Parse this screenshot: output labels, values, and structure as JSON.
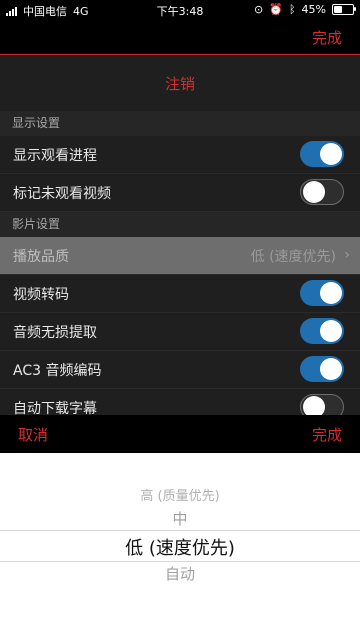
{
  "status_bar": {
    "carrier": "中国电信",
    "network": "4G",
    "time": "下午3:48",
    "battery": "45%",
    "battery_level": 0.45
  },
  "header": {
    "done_label": "完成"
  },
  "actions": {
    "logout_label": "注销"
  },
  "sections": {
    "display": {
      "title": "显示设置",
      "items": [
        {
          "label": "显示观看进程",
          "toggle": true
        },
        {
          "label": "标记未观看视频",
          "toggle": false
        }
      ]
    },
    "video": {
      "title": "影片设置",
      "quality": {
        "label": "播放品质",
        "value": "低 (速度优先)"
      },
      "items": [
        {
          "label": "视频转码",
          "toggle": true
        },
        {
          "label": "音频无损提取",
          "toggle": true
        },
        {
          "label": "AC3 音频编码",
          "toggle": true
        },
        {
          "label": "自动下载字幕",
          "toggle": false
        }
      ]
    }
  },
  "picker": {
    "cancel_label": "取消",
    "done_label": "完成",
    "options": [
      "高 (质量优先)",
      "中",
      "低 (速度优先)",
      "自动"
    ],
    "selected": "低 (速度优先)"
  },
  "colors": {
    "accent": "#d32f2f",
    "toggle_on": "#1f6fb1",
    "background": "#1f1f1f"
  }
}
